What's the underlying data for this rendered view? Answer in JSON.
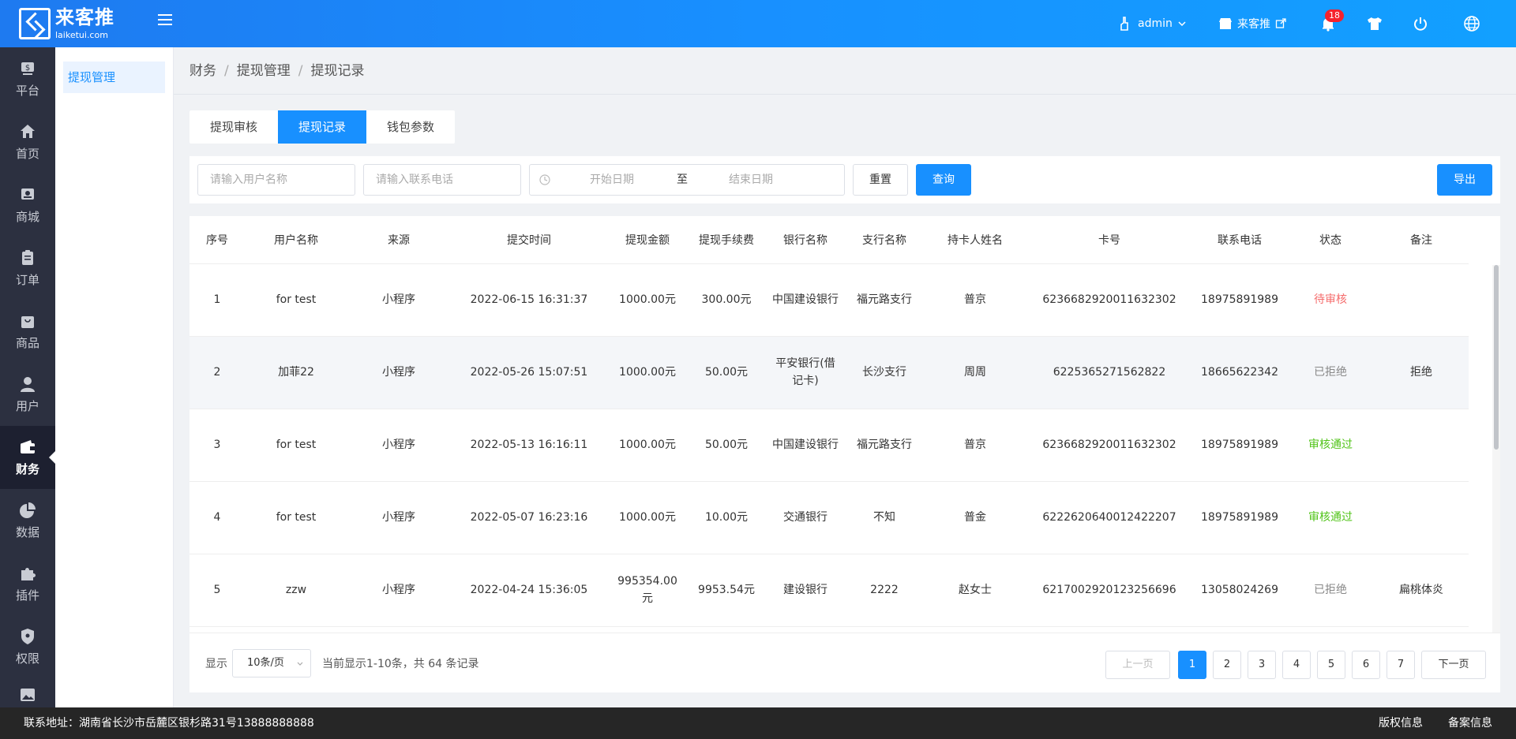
{
  "header": {
    "logo_name": "来客推",
    "logo_domain": "laiketui.com",
    "user": "admin",
    "store": "来客推",
    "notif_count": "18"
  },
  "sidebar": {
    "items": [
      {
        "label": "平台",
        "icon": "dollar-icon"
      },
      {
        "label": "首页",
        "icon": "home-icon"
      },
      {
        "label": "商城",
        "icon": "store-icon"
      },
      {
        "label": "订单",
        "icon": "clipboard-icon"
      },
      {
        "label": "商品",
        "icon": "bag-icon"
      },
      {
        "label": "用户",
        "icon": "user-icon"
      },
      {
        "label": "财务",
        "icon": "wallet-icon"
      },
      {
        "label": "数据",
        "icon": "pie-chart-icon"
      },
      {
        "label": "插件",
        "icon": "puzzle-icon"
      },
      {
        "label": "权限",
        "icon": "shield-icon"
      }
    ]
  },
  "subsidebar": {
    "item": "提现管理"
  },
  "breadcrumb": [
    "财务",
    "提现管理",
    "提现记录"
  ],
  "tabs": [
    "提现审核",
    "提现记录",
    "钱包参数"
  ],
  "filters": {
    "username_placeholder": "请输入用户名称",
    "phone_placeholder": "请输入联系电话",
    "start_date": "开始日期",
    "to": "至",
    "end_date": "结束日期",
    "reset": "重置",
    "query": "查询",
    "export": "导出"
  },
  "table": {
    "columns": [
      "序号",
      "用户名称",
      "来源",
      "提交时间",
      "提现金额",
      "提现手续费",
      "银行名称",
      "支行名称",
      "持卡人姓名",
      "卡号",
      "联系电话",
      "状态",
      "备注"
    ],
    "rows": [
      {
        "no": "1",
        "user": "for test",
        "source": "小程序",
        "time": "2022-06-15 16:31:37",
        "amount": "1000.00元",
        "fee": "300.00元",
        "bank": "中国建设银行",
        "branch": "福元路支行",
        "holder": "普京",
        "card": "6236682920011632302",
        "phone": "18975891989",
        "status": "待审核",
        "status_color": "#f56c6c",
        "note": ""
      },
      {
        "no": "2",
        "user": "加菲22",
        "source": "小程序",
        "time": "2022-05-26 15:07:51",
        "amount": "1000.00元",
        "fee": "50.00元",
        "bank": "平安银行(借记卡)",
        "branch": "长沙支行",
        "holder": "周周",
        "card": "6225365271562822",
        "phone": "18665622342",
        "status": "已拒绝",
        "status_color": "#888888",
        "note": "拒绝"
      },
      {
        "no": "3",
        "user": "for test",
        "source": "小程序",
        "time": "2022-05-13 16:16:11",
        "amount": "1000.00元",
        "fee": "50.00元",
        "bank": "中国建设银行",
        "branch": "福元路支行",
        "holder": "普京",
        "card": "6236682920011632302",
        "phone": "18975891989",
        "status": "审核通过",
        "status_color": "#52c41a",
        "note": ""
      },
      {
        "no": "4",
        "user": "for test",
        "source": "小程序",
        "time": "2022-05-07 16:23:16",
        "amount": "1000.00元",
        "fee": "10.00元",
        "bank": "交通银行",
        "branch": "不知",
        "holder": "普金",
        "card": "6222620640012422207",
        "phone": "18975891989",
        "status": "审核通过",
        "status_color": "#52c41a",
        "note": ""
      },
      {
        "no": "5",
        "user": "zzw",
        "source": "小程序",
        "time": "2022-04-24 15:36:05",
        "amount": "995354.00元",
        "fee": "9953.54元",
        "bank": "建设银行",
        "branch": "2222",
        "holder": "赵女士",
        "card": "6217002920123256696",
        "phone": "13058024269",
        "status": "已拒绝",
        "status_color": "#888888",
        "note": "扁桃体炎"
      }
    ]
  },
  "pager": {
    "show_label": "显示",
    "page_size": "10条/页",
    "summary": "当前显示1-10条，共 64 条记录",
    "prev": "上一页",
    "next": "下一页",
    "pages": [
      "1",
      "2",
      "3",
      "4",
      "5",
      "6",
      "7"
    ],
    "current": "1"
  },
  "footer": {
    "address": "联系地址：湖南省长沙市岳麓区银杉路31号13888888888",
    "copyright": "版权信息",
    "icp": "备案信息"
  }
}
